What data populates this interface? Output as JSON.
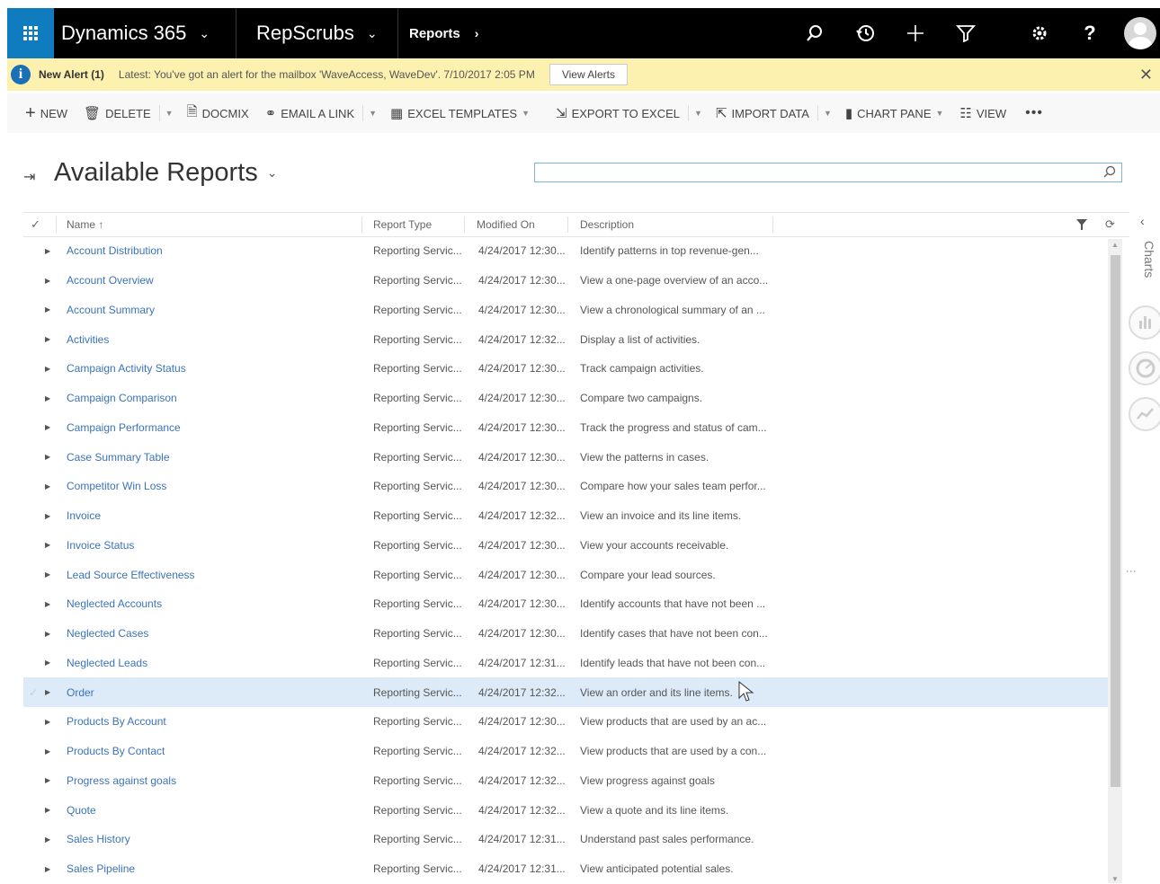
{
  "topbar": {
    "app_name": "Dynamics 365",
    "area_name": "RepScrubs",
    "breadcrumb": "Reports",
    "icons": [
      "waffle-icon",
      "search-icon",
      "history-icon",
      "plus-icon",
      "filter-icon",
      "gear-icon",
      "help-icon",
      "user-avatar"
    ],
    "help_label": "?",
    "background": "#000000",
    "waffle_color": "#0f7cbf"
  },
  "alert": {
    "title": "New Alert (1)",
    "message": "Latest: You've got an alert for the mailbox 'WaveAccess, WaveDev'. 7/10/2017 2:05 PM",
    "button": "View Alerts",
    "close": "✕",
    "background": "#fdf1b0"
  },
  "commands": {
    "new": "NEW",
    "delete": "DELETE",
    "docmix": "DOCMIX",
    "email_link": "EMAIL A LINK",
    "excel_templates": "EXCEL TEMPLATES",
    "export_excel": "EXPORT TO EXCEL",
    "import_data": "IMPORT DATA",
    "chart_pane": "CHART PANE",
    "view": "VIEW",
    "more": "•••"
  },
  "page": {
    "title": "Available Reports",
    "search_value": ""
  },
  "grid": {
    "columns": {
      "name": "Name ↑",
      "type": "Report Type",
      "modified": "Modified On",
      "description": "Description"
    },
    "rows": [
      {
        "name": "Account Distribution",
        "type": "Reporting Servic...",
        "modified": "4/24/2017 12:30...",
        "description": "Identify patterns in top revenue-gen..."
      },
      {
        "name": "Account Overview",
        "type": "Reporting Servic...",
        "modified": "4/24/2017 12:30...",
        "description": "View a one-page overview of an acco..."
      },
      {
        "name": "Account Summary",
        "type": "Reporting Servic...",
        "modified": "4/24/2017 12:30...",
        "description": "View a chronological summary of an ..."
      },
      {
        "name": "Activities",
        "type": "Reporting Servic...",
        "modified": "4/24/2017 12:32...",
        "description": "Display a list of activities."
      },
      {
        "name": "Campaign Activity Status",
        "type": "Reporting Servic...",
        "modified": "4/24/2017 12:30...",
        "description": "Track campaign activities."
      },
      {
        "name": "Campaign Comparison",
        "type": "Reporting Servic...",
        "modified": "4/24/2017 12:30...",
        "description": "Compare two campaigns."
      },
      {
        "name": "Campaign Performance",
        "type": "Reporting Servic...",
        "modified": "4/24/2017 12:30...",
        "description": "Track the progress and status of cam..."
      },
      {
        "name": "Case Summary Table",
        "type": "Reporting Servic...",
        "modified": "4/24/2017 12:30...",
        "description": "View the patterns in cases."
      },
      {
        "name": "Competitor Win Loss",
        "type": "Reporting Servic...",
        "modified": "4/24/2017 12:30...",
        "description": "Compare how your sales team perfor..."
      },
      {
        "name": "Invoice",
        "type": "Reporting Servic...",
        "modified": "4/24/2017 12:32...",
        "description": "View an invoice and its line items."
      },
      {
        "name": "Invoice Status",
        "type": "Reporting Servic...",
        "modified": "4/24/2017 12:30...",
        "description": "View your accounts receivable."
      },
      {
        "name": "Lead Source Effectiveness",
        "type": "Reporting Servic...",
        "modified": "4/24/2017 12:30...",
        "description": "Compare your lead sources."
      },
      {
        "name": "Neglected Accounts",
        "type": "Reporting Servic...",
        "modified": "4/24/2017 12:30...",
        "description": "Identify accounts that have not been ..."
      },
      {
        "name": "Neglected Cases",
        "type": "Reporting Servic...",
        "modified": "4/24/2017 12:30...",
        "description": "Identify cases that have not been con..."
      },
      {
        "name": "Neglected Leads",
        "type": "Reporting Servic...",
        "modified": "4/24/2017 12:31...",
        "description": "Identify leads that have not been con..."
      },
      {
        "name": "Order",
        "type": "Reporting Servic...",
        "modified": "4/24/2017 12:32...",
        "description": "View an order and its line items.",
        "selected": true
      },
      {
        "name": "Products By Account",
        "type": "Reporting Servic...",
        "modified": "4/24/2017 12:30...",
        "description": "View products that are used by an ac..."
      },
      {
        "name": "Products By Contact",
        "type": "Reporting Servic...",
        "modified": "4/24/2017 12:32...",
        "description": "View products that are used by a con..."
      },
      {
        "name": "Progress against goals",
        "type": "Reporting Servic...",
        "modified": "4/24/2017 12:32...",
        "description": "View progress against goals"
      },
      {
        "name": "Quote",
        "type": "Reporting Servic...",
        "modified": "4/24/2017 12:32...",
        "description": "View a quote and its line items."
      },
      {
        "name": "Sales History",
        "type": "Reporting Servic...",
        "modified": "4/24/2017 12:31...",
        "description": "Understand past sales performance."
      },
      {
        "name": "Sales Pipeline",
        "type": "Reporting Servic...",
        "modified": "4/24/2017 12:31...",
        "description": "View anticipated potential sales."
      }
    ]
  },
  "chart_pane": {
    "label": "Charts",
    "collapse": "‹"
  },
  "colors": {
    "link": "#3b73b9",
    "selected_row": "#dcebf7"
  }
}
